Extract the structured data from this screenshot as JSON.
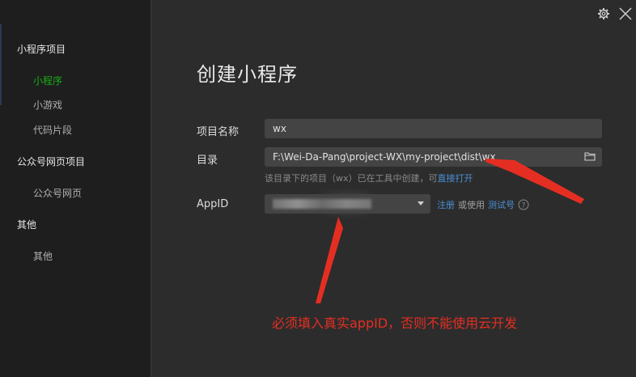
{
  "sidebar": {
    "groups": [
      {
        "title": "小程序项目",
        "items": [
          "小程序",
          "小游戏",
          "代码片段"
        ]
      },
      {
        "title": "公众号网页项目",
        "items": [
          "公众号网页"
        ]
      },
      {
        "title": "其他",
        "items": [
          "其他"
        ]
      }
    ]
  },
  "main": {
    "title": "创建小程序",
    "project_name": {
      "label": "项目名称",
      "value": "wx"
    },
    "directory": {
      "label": "目录",
      "value": "F:\\Wei-Da-Pang\\project-WX\\my-project\\dist\\wx",
      "hint_prefix": "该目录下的项目（wx）已在工具中创建，可",
      "hint_link": "直接打开"
    },
    "appid": {
      "label": "AppID",
      "register_link": "注册",
      "or_use": "或使用",
      "test_link": "测试号"
    }
  },
  "annotation": {
    "text": "必须填入真实appID，否则不能使用云开发",
    "color": "#e52e22"
  },
  "icons": [
    "gear-icon",
    "close-icon",
    "folder-icon",
    "caret-down-icon",
    "help-icon"
  ],
  "colors": {
    "accent": "#1aad19",
    "link": "#4a90d9",
    "annotation": "#e52e22"
  }
}
